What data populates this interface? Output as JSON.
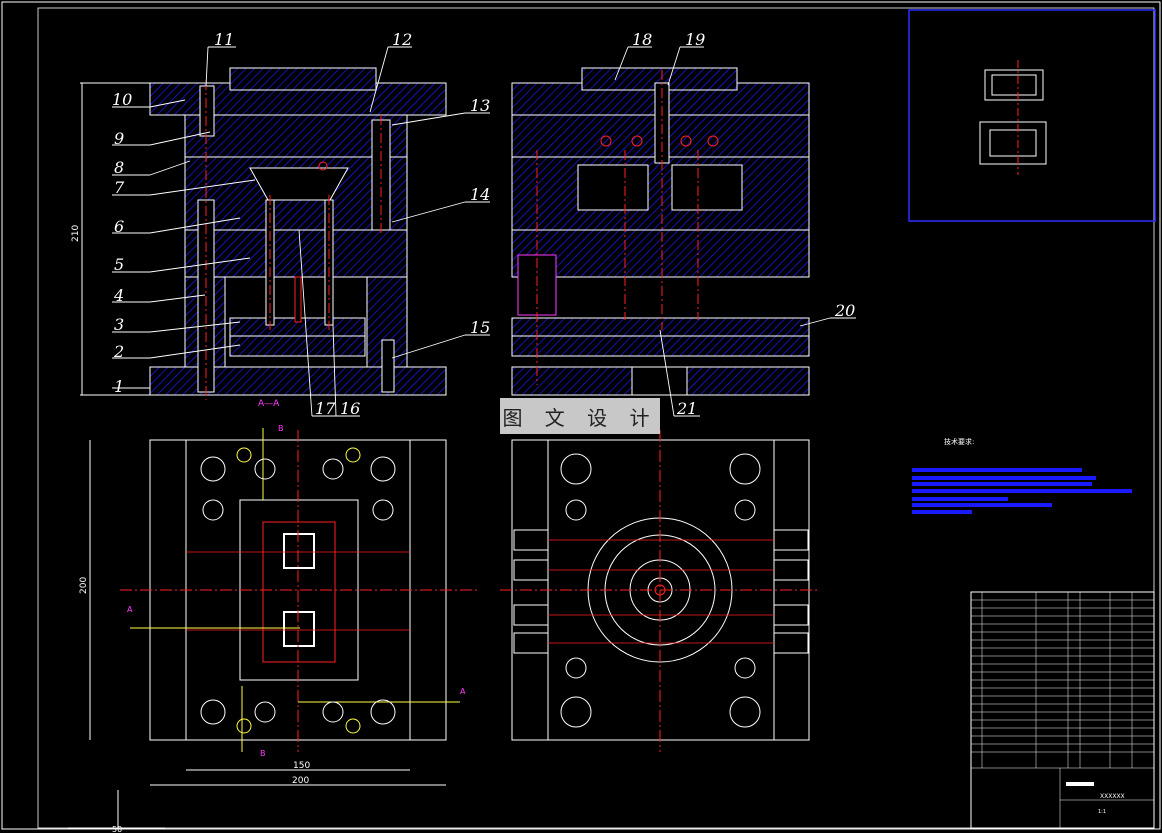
{
  "drawing": {
    "part_numbers": [
      "1",
      "2",
      "3",
      "4",
      "5",
      "6",
      "7",
      "8",
      "9",
      "10",
      "11",
      "12",
      "13",
      "14",
      "15",
      "16",
      "17",
      "18",
      "19",
      "20",
      "21"
    ],
    "section_label": "A—A",
    "section_markers": {
      "a": "A",
      "b": "B"
    },
    "dimensions": {
      "overall_height": "210",
      "plan_height": "200",
      "inner_width": "150",
      "overall_width": "200",
      "base_bottom": "50"
    },
    "tech_requirements_title": "技术要求:"
  },
  "watermark": "图 文 设 计",
  "title_block": {
    "drawing_name": "XXXXXX",
    "scale_text": "1:1"
  },
  "colors": {
    "line": "#ffffff",
    "hatch": "#1a1aff",
    "center": "#ff2020",
    "dimension": "#ffffff",
    "label": "#ffffff",
    "highlight": "#ff3cff",
    "yellow": "#ffff40"
  }
}
